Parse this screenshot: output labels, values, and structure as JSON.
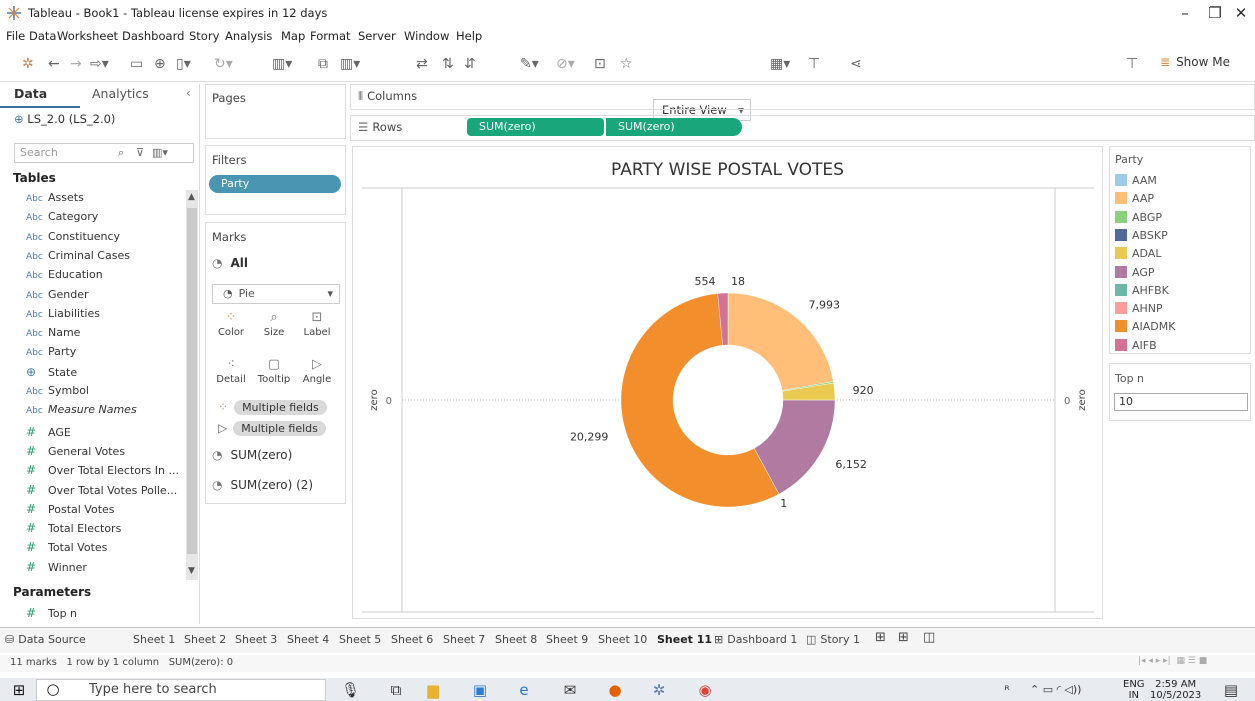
{
  "window": {
    "title": "Tableau - Book1 - Tableau license expires in 12 days"
  },
  "menu": [
    "File",
    "Data",
    "Worksheet",
    "Dashboard",
    "Story",
    "Analysis",
    "Map",
    "Format",
    "Server",
    "Window",
    "Help"
  ],
  "toolbar": {
    "fit": "Entire View",
    "show_me": "Show Me"
  },
  "data_pane": {
    "tab_data": "Data",
    "tab_analytics": "Analytics",
    "datasource": "LS_2.0 (LS_2.0)",
    "search_placeholder": "Search",
    "tables_header": "Tables",
    "dimensions": [
      {
        "type": "Abc",
        "name": "Assets"
      },
      {
        "type": "Abc",
        "name": "Category"
      },
      {
        "type": "Abc",
        "name": "Constituency"
      },
      {
        "type": "Abc",
        "name": "Criminal Cases"
      },
      {
        "type": "Abc",
        "name": "Education"
      },
      {
        "type": "Abc",
        "name": "Gender"
      },
      {
        "type": "Abc",
        "name": "Liabilities"
      },
      {
        "type": "Abc",
        "name": "Name"
      },
      {
        "type": "Abc",
        "name": "Party"
      },
      {
        "type": "globe",
        "name": "State"
      },
      {
        "type": "Abc",
        "name": "Symbol"
      },
      {
        "type": "Abc",
        "name": "Measure Names"
      }
    ],
    "measures": [
      "AGE",
      "General Votes",
      "Over Total Electors In ...",
      "Over Total Votes Polle...",
      "Postal Votes",
      "Total Electors",
      "Total Votes",
      "Winner"
    ],
    "parameters_header": "Parameters",
    "parameters": [
      "Top n"
    ]
  },
  "shelves": {
    "pages": "Pages",
    "filters": "Filters",
    "filter_pill": "Party",
    "marks": "Marks",
    "marks_all": "All",
    "mark_type": "Pie",
    "mark_buttons": [
      "Color",
      "Size",
      "Label",
      "Detail",
      "Tooltip",
      "Angle"
    ],
    "mark_fields": [
      "Multiple fields",
      "Multiple fields"
    ],
    "mark_layers": [
      "SUM(zero)",
      "SUM(zero) (2)"
    ],
    "columns_label": "Columns",
    "rows_label": "Rows",
    "row_pills": [
      "SUM(zero)",
      "SUM(zero)"
    ]
  },
  "legend": {
    "title": "Party",
    "items": [
      {
        "name": "AAM",
        "color": "#9ecae9"
      },
      {
        "name": "AAP",
        "color": "#ffbf79"
      },
      {
        "name": "ABGP",
        "color": "#8bd17c"
      },
      {
        "name": "ABSKP",
        "color": "#4e6b9c"
      },
      {
        "name": "ADAL",
        "color": "#e9c94f"
      },
      {
        "name": "AGP",
        "color": "#b07aa1"
      },
      {
        "name": "AHFBK",
        "color": "#6db7a9"
      },
      {
        "name": "AHNP",
        "color": "#ff9d9a"
      },
      {
        "name": "AIADMK",
        "color": "#f28e2b"
      },
      {
        "name": "AIFB",
        "color": "#d37295"
      }
    ]
  },
  "topn": {
    "title": "Top n",
    "value": "10"
  },
  "chart_data": {
    "type": "pie",
    "title": "PARTY WISE POSTAL VOTES",
    "axis_left_label": "zero",
    "axis_right_label": "zero",
    "axis_left_tick": "0",
    "axis_right_tick": "0",
    "slices": [
      {
        "party": "AHNP",
        "value": 18,
        "label": "18",
        "color": "#ff9d9a"
      },
      {
        "party": "AAP",
        "value": 7993,
        "label": "7,993",
        "color": "#ffbf79"
      },
      {
        "party": "ABGP",
        "value": 80,
        "label": "",
        "color": "#8bd17c"
      },
      {
        "party": "ADAL",
        "value": 920,
        "label": "920",
        "color": "#e9c94f"
      },
      {
        "party": "AGP",
        "value": 6152,
        "label": "6,152",
        "color": "#b07aa1"
      },
      {
        "party": "AHFBK",
        "value": 1,
        "label": "1",
        "color": "#6db7a9"
      },
      {
        "party": "AIADMK",
        "value": 20299,
        "label": "20,299",
        "color": "#f28e2b"
      },
      {
        "party": "AIFB",
        "value": 554,
        "label": "554",
        "color": "#d37295"
      }
    ]
  },
  "sheet_tabs": {
    "data_source": "Data Source",
    "sheets": [
      "Sheet 1",
      "Sheet 2",
      "Sheet 3",
      "Sheet 4",
      "Sheet 5",
      "Sheet 6",
      "Sheet 7",
      "Sheet 8",
      "Sheet 9",
      "Sheet 10",
      "Sheet 11"
    ],
    "active": "Sheet 11",
    "dashboard": "Dashboard 1",
    "story": "Story 1"
  },
  "status": {
    "marks": "11 marks",
    "rows": "1 row by 1 column",
    "sum": "SUM(zero): 0"
  },
  "taskbar": {
    "search": "Type here to search",
    "lang1": "ENG",
    "lang2": "IN",
    "time": "2:59 AM",
    "date": "10/5/2023"
  }
}
